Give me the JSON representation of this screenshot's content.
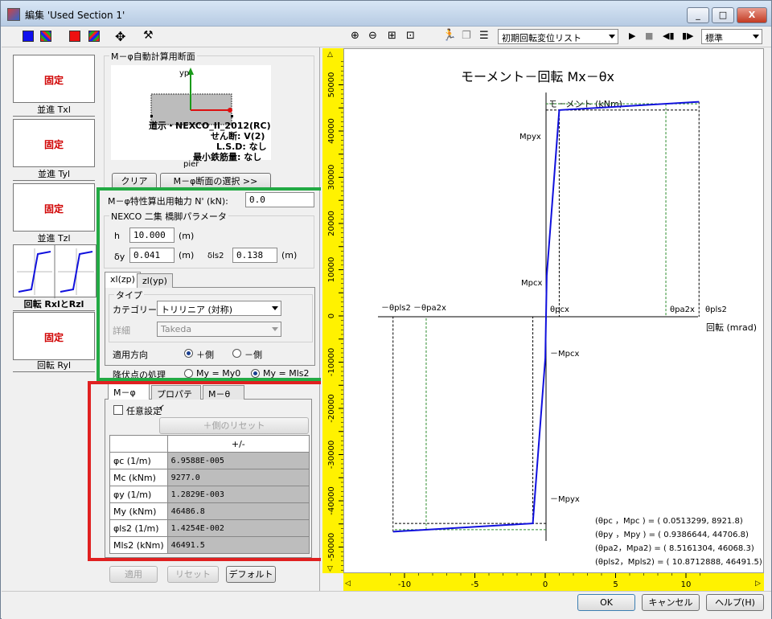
{
  "window": {
    "title": "編集 'Used Section 1'",
    "btn_min": "_",
    "btn_max": "□",
    "btn_close": "X"
  },
  "toolbar": {
    "dropdown": "初期回転変位リスト",
    "style_select": "標準"
  },
  "springs": [
    {
      "label": "並進 Txl",
      "state": "固定"
    },
    {
      "label": "並進 Tyl",
      "state": "固定"
    },
    {
      "label": "並進 Tzl",
      "state": "固定"
    },
    {
      "label": "回転 RxlとRzl",
      "state": ""
    },
    {
      "label": "回転 Ryl",
      "state": "固定"
    }
  ],
  "section": {
    "group": "M－φ自動計算用断面",
    "yp": "yp",
    "lines": [
      "道示・NEXCO_II_2012(RC)",
      "せん断: V(2)",
      "L.S.D: なし",
      "最小鉄筋量: なし"
    ],
    "name": "pier",
    "clear_btn": "クリア",
    "select_btn": "M－φ断面の選択 >>"
  },
  "axial": {
    "label": "M－φ特性算出用軸力 N' (kN):",
    "value": "0.0"
  },
  "nexco": {
    "group": "NEXCO 二集 橋脚パラメータ",
    "h_label": "h",
    "h_value": "10.000",
    "h_unit": "(m)",
    "dy_label": "δy",
    "dy_value": "0.041",
    "dy_unit": "(m)",
    "dls2_label": "δls2",
    "dls2_value": "0.138",
    "dls2_unit": "(m)"
  },
  "axis_tabs": [
    "xl(zp)",
    "zl(yp)"
  ],
  "type": {
    "group": "タイプ",
    "category_label": "カテゴリー",
    "category_value": "トリリニア (対称)",
    "detail_label": "詳細",
    "detail_value": "Takeda"
  },
  "direction": {
    "label": "適用方向",
    "opt_plus": "＋側",
    "opt_minus": "－側"
  },
  "yield": {
    "label": "降伏点の処理",
    "opt1": "My = My0",
    "opt2": "My = Mls2"
  },
  "sub_tabs": [
    "M－φ",
    "プロパティ",
    "M－θ"
  ],
  "arbitrary": {
    "label": "任意設定",
    "reset_plus": "＋側のリセット"
  },
  "mphi_table": {
    "header": "+/-",
    "rows": [
      {
        "name": "φc (1/m)",
        "value": "6.9588E-005"
      },
      {
        "name": "Mc (kNm)",
        "value": "9277.0"
      },
      {
        "name": "φy (1/m)",
        "value": "1.2829E-003"
      },
      {
        "name": "My (kNm)",
        "value": "46486.8"
      },
      {
        "name": "φls2 (1/m)",
        "value": "1.4254E-002"
      },
      {
        "name": "Mls2 (kNm)",
        "value": "46491.5"
      }
    ]
  },
  "bottom_left": {
    "apply": "適用",
    "reset": "リセット",
    "default": "デフォルト"
  },
  "dialog": {
    "ok": "OK",
    "cancel": "キャンセル",
    "help": "ヘルプ(H)"
  },
  "chart_data": {
    "type": "line",
    "title": "モーメント－回転 Mx－θx",
    "xlabel": "回転 (mrad)",
    "ylabel": "モーメント (kNm)",
    "xlim": [
      -11.5,
      11.5
    ],
    "ylim": [
      -56000,
      56000
    ],
    "x_ticks": [
      -10,
      -5,
      0,
      5,
      10
    ],
    "y_ticks": [
      -50000,
      -45000,
      -40000,
      -35000,
      -30000,
      -25000,
      -20000,
      -15000,
      -10000,
      -5000,
      0,
      5000,
      10000,
      15000,
      20000,
      25000,
      30000,
      35000,
      40000,
      45000,
      50000
    ],
    "series": [
      {
        "color": "#1010dd",
        "x": [
          -10.8712888,
          -0.9386644,
          -0.0513299,
          0.0513299,
          0.9386644,
          10.8712888
        ],
        "y": [
          -46491.5,
          -44706.8,
          -8921.8,
          8921.8,
          44706.8,
          46491.5
        ]
      }
    ],
    "reference_labels": {
      "mpyx": "Mpyx",
      "mpcx": "Mpcx",
      "neg_mpcx": "－Mpcx",
      "neg_mpyx": "－Mpyx",
      "th_pcx": "θpcx",
      "th_pa2x": "θpa2x",
      "th_pls2": "θpls2",
      "neg_th_pls2": "－θpls2",
      "neg_th_pa2x": "－θpa2x"
    },
    "ref_x": {
      "pcx": 0.0513299,
      "pa2x": 8.5161304,
      "pls2": 10.8712888
    },
    "ref_y": {
      "mpcx": 8921.8,
      "mpyx": 44706.8,
      "mpa2": 46068.3
    },
    "annotations": [
      "(θpc ，Mpc ) = (  0.0513299,   8921.8)",
      "(θpy ，Mpy ) = (  0.9386644, 44706.8)",
      "(θpa2，Mpa2) = (  8.5161304, 46068.3)",
      "(θpls2，Mpls2) = ( 10.8712888, 46491.5)"
    ],
    "colors": {
      "curve": "#1010dd",
      "guide": "#2a8a2a",
      "ruler": "#fff200"
    }
  }
}
